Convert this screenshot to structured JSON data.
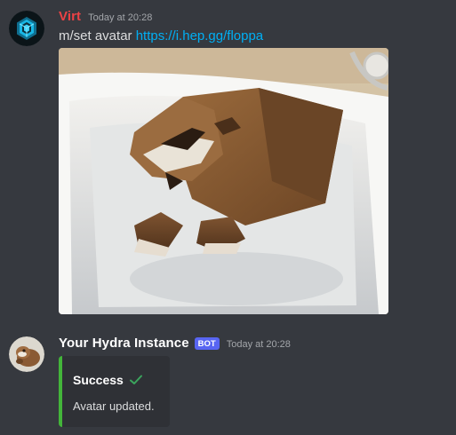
{
  "messages": [
    {
      "author": "Virt",
      "author_color": "#ed4245",
      "timestamp": "Today at 20:28",
      "command": "m/set avatar",
      "link": "https://i.hep.gg/floppa",
      "avatar_icon": "hexagon-logo-icon",
      "attachment": "floppa-cat-in-bathtub-image"
    },
    {
      "author": "Your Hydra Instance",
      "author_color": "#ffffff",
      "bot_tag": "BOT",
      "timestamp": "Today at 20:28",
      "avatar_icon": "floppa-avatar",
      "embed": {
        "title": "Success",
        "title_icon": "checkmark-icon",
        "description": "Avatar updated.",
        "accent_color": "#43b53a"
      }
    }
  ]
}
